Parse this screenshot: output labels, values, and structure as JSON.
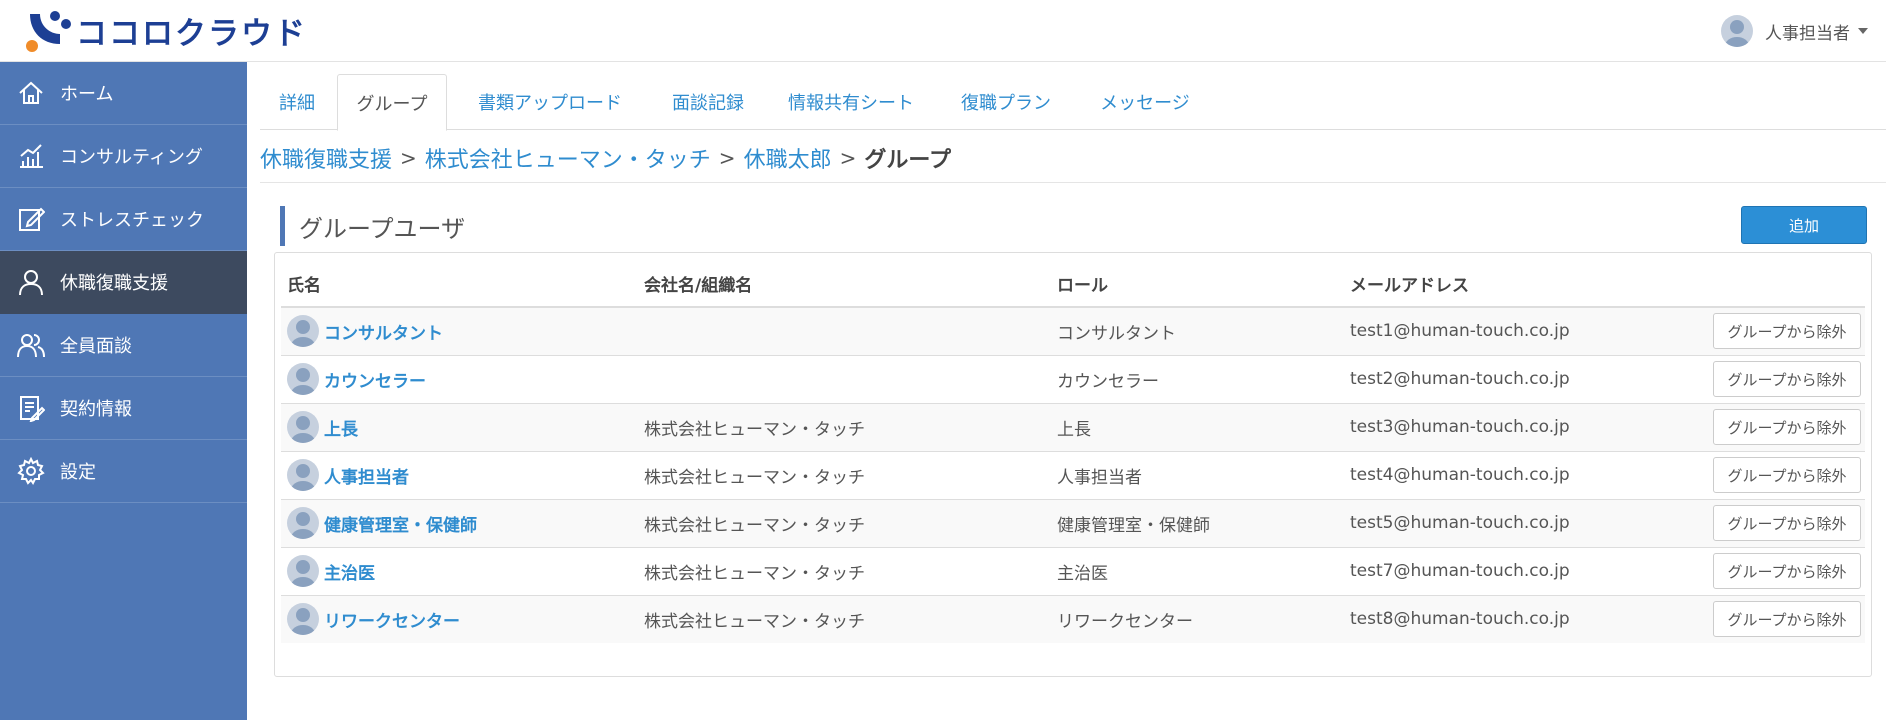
{
  "app": {
    "logo_text": "ココロクラウド",
    "user_name": "人事担当者"
  },
  "sidebar": {
    "items": [
      {
        "label": "ホーム",
        "icon": "home-icon"
      },
      {
        "label": "コンサルティング",
        "icon": "chart-icon"
      },
      {
        "label": "ストレスチェック",
        "icon": "edit-icon"
      },
      {
        "label": "休職復職支援",
        "icon": "user-icon",
        "active": true
      },
      {
        "label": "全員面談",
        "icon": "users-icon"
      },
      {
        "label": "契約情報",
        "icon": "document-icon"
      },
      {
        "label": "設定",
        "icon": "gear-icon"
      }
    ]
  },
  "tabs": [
    {
      "label": "詳細"
    },
    {
      "label": "グループ",
      "active": true
    },
    {
      "label": "書類アップロード"
    },
    {
      "label": "面談記録"
    },
    {
      "label": "情報共有シート"
    },
    {
      "label": "復職プラン"
    },
    {
      "label": "メッセージ"
    }
  ],
  "breadcrumb": {
    "items": [
      "休職復職支援",
      "株式会社ヒューマン・タッチ",
      "休職太郎"
    ],
    "separator": ">",
    "current": "グループ"
  },
  "section": {
    "title": "グループユーザ",
    "add_label": "追加"
  },
  "table": {
    "columns": [
      "氏名",
      "会社名/組織名",
      "ロール",
      "メールアドレス"
    ],
    "remove_label": "グループから除外",
    "rows": [
      {
        "name": "コンサルタント",
        "company": "",
        "role": "コンサルタント",
        "email": "test1@human-touch.co.jp"
      },
      {
        "name": "カウンセラー",
        "company": "",
        "role": "カウンセラー",
        "email": "test2@human-touch.co.jp"
      },
      {
        "name": "上長",
        "company": "株式会社ヒューマン・タッチ",
        "role": "上長",
        "email": "test3@human-touch.co.jp"
      },
      {
        "name": "人事担当者",
        "company": "株式会社ヒューマン・タッチ",
        "role": "人事担当者",
        "email": "test4@human-touch.co.jp"
      },
      {
        "name": "健康管理室・保健師",
        "company": "株式会社ヒューマン・タッチ",
        "role": "健康管理室・保健師",
        "email": "test5@human-touch.co.jp"
      },
      {
        "name": "主治医",
        "company": "株式会社ヒューマン・タッチ",
        "role": "主治医",
        "email": "test7@human-touch.co.jp"
      },
      {
        "name": "リワークセンター",
        "company": "株式会社ヒューマン・タッチ",
        "role": "リワークセンター",
        "email": "test8@human-touch.co.jp"
      }
    ]
  },
  "colors": {
    "sidebar": "#4f77b5",
    "sidebar_active": "#3d4a5f",
    "link": "#2f8ccf",
    "primary_button": "#2c8fd6",
    "logo": "#1d3f94"
  }
}
